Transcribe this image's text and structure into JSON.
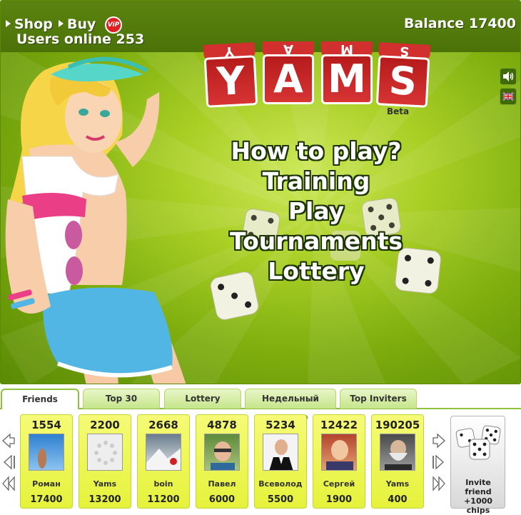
{
  "topbar": {
    "shop_label": "Shop",
    "buy_label": "Buy",
    "vip_label": "ViP",
    "online_label": "Users online 253",
    "balance_label": "Balance 17400"
  },
  "logo": {
    "cube_faces": [
      "Y",
      "A",
      "M",
      "S"
    ],
    "cube_tops": [
      "Y",
      "A",
      "M",
      "S"
    ],
    "beta_label": "Beta"
  },
  "side_buttons": {
    "sound_icon": "speaker-icon",
    "language_icon": "uk-flag-icon"
  },
  "menu": {
    "items": [
      "How to play?",
      "Training",
      "Play",
      "Tournaments",
      "Lottery"
    ]
  },
  "tabs": [
    {
      "label": "Friends",
      "active": true
    },
    {
      "label": "Top 30",
      "active": false
    },
    {
      "label": "Lottery",
      "active": false
    },
    {
      "label": "Недельный турнир",
      "active": false
    },
    {
      "label": "Top Inviters",
      "active": false
    }
  ],
  "friends": [
    {
      "score": "1554",
      "name": "Роман",
      "chips": "17400"
    },
    {
      "score": "2200",
      "name": "Yams",
      "chips": "13200"
    },
    {
      "score": "2668",
      "name": "boin",
      "chips": "11200"
    },
    {
      "score": "4878",
      "name": "Павел",
      "chips": "6000"
    },
    {
      "score": "5234",
      "name": "Всеволод",
      "chips": "5500"
    },
    {
      "score": "12422",
      "name": "Сергей",
      "chips": "1900"
    },
    {
      "score": "190205",
      "name": "Yams",
      "chips": "400"
    }
  ],
  "invite": {
    "line1": "Invite friend",
    "line2": "+1000 chips"
  },
  "colors": {
    "game_green": "#9cc81c",
    "topbar_green": "#4f770a",
    "card_yellow": "#e9f444",
    "tab_border": "#8fc23a",
    "cube_red": "#c42222"
  }
}
